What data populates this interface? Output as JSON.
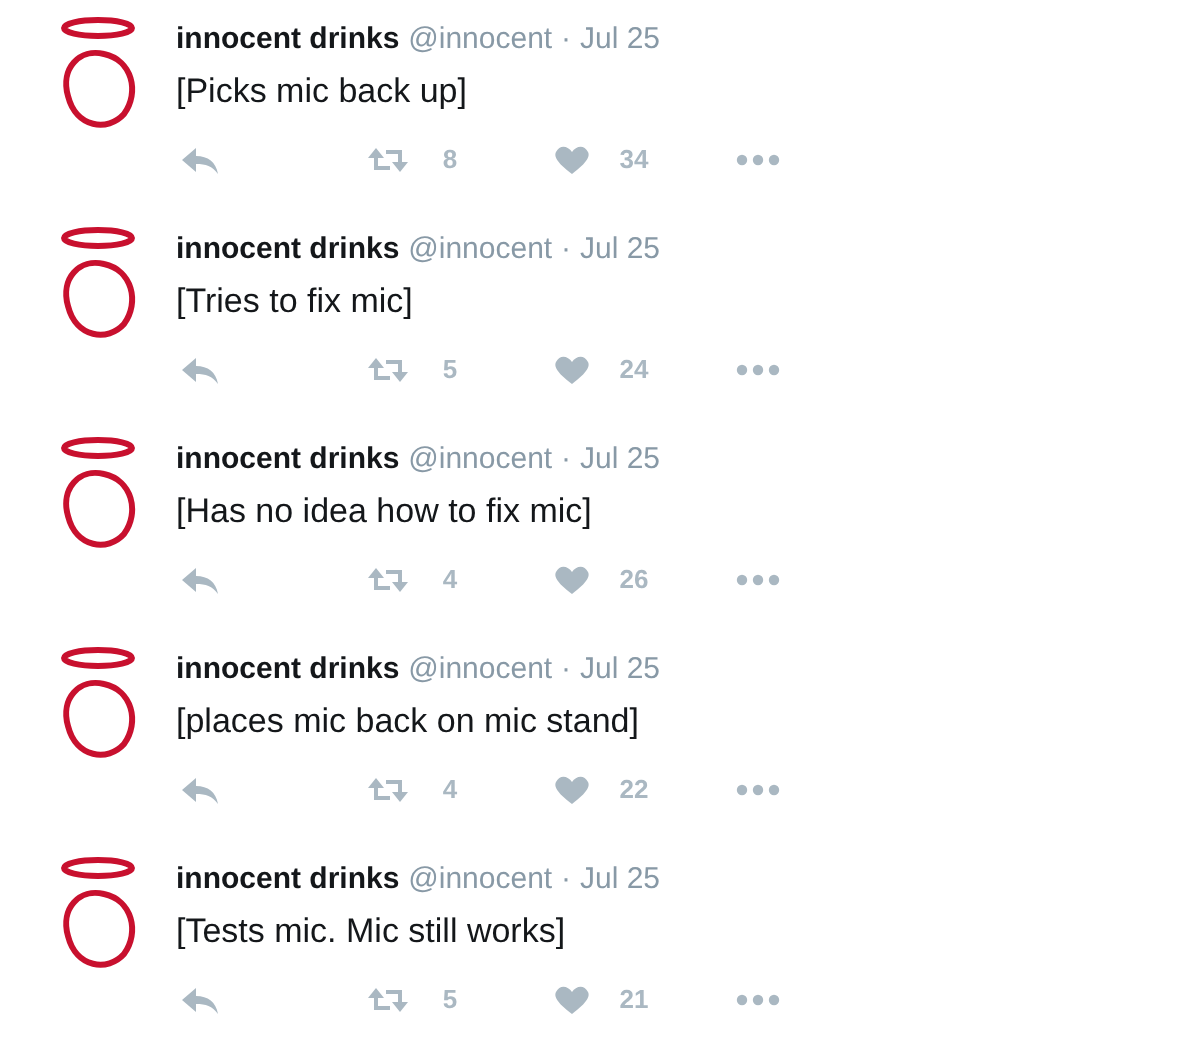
{
  "tweets": [
    {
      "name": "innocent drinks",
      "handle": "@innocent",
      "separator": "·",
      "date": "Jul 25",
      "text": "[Picks mic back up]",
      "retweets": "8",
      "likes": "34"
    },
    {
      "name": "innocent drinks",
      "handle": "@innocent",
      "separator": "·",
      "date": "Jul 25",
      "text": "[Tries to fix mic]",
      "retweets": "5",
      "likes": "24"
    },
    {
      "name": "innocent drinks",
      "handle": "@innocent",
      "separator": "·",
      "date": "Jul 25",
      "text": "[Has no idea how to fix mic]",
      "retweets": "4",
      "likes": "26"
    },
    {
      "name": "innocent drinks",
      "handle": "@innocent",
      "separator": "·",
      "date": "Jul 25",
      "text": "[places mic back on mic stand]",
      "retweets": "4",
      "likes": "22"
    },
    {
      "name": "innocent drinks",
      "handle": "@innocent",
      "separator": "·",
      "date": "Jul 25",
      "text": "[Tests mic. Mic still works]",
      "retweets": "5",
      "likes": "21"
    }
  ]
}
